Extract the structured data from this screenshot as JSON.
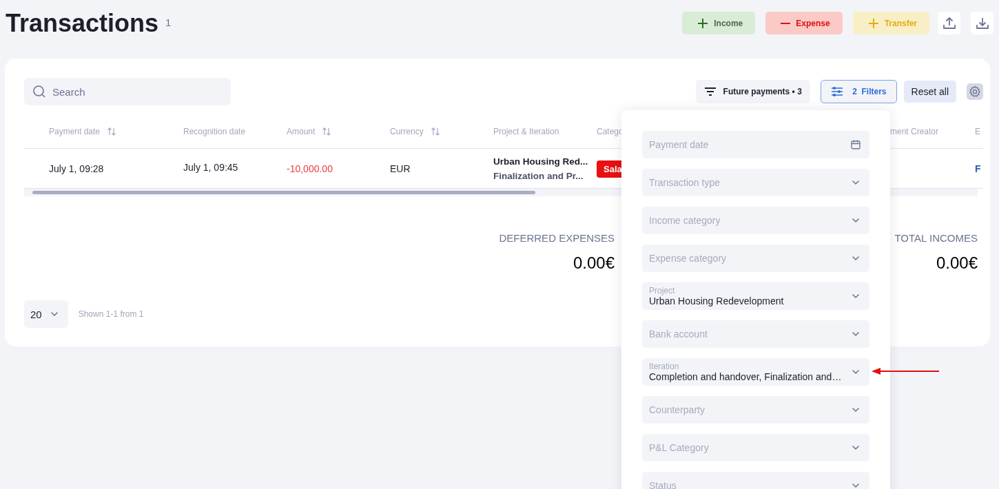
{
  "header": {
    "title": "Transactions",
    "count": "1",
    "actions": [
      {
        "kind": "income",
        "label": "Income"
      },
      {
        "kind": "expense",
        "label": "Expense"
      },
      {
        "kind": "transfer",
        "label": "Transfer"
      }
    ]
  },
  "toolbar": {
    "search": {
      "placeholder": "Search"
    },
    "future_payments": {
      "label": "Future payments • 3"
    },
    "filters": {
      "count": "2",
      "label": "Filters"
    },
    "reset": "Reset all"
  },
  "table": {
    "columns": [
      {
        "label": "Payment date",
        "sortable": true
      },
      {
        "label": "Recognition date",
        "sortable": false
      },
      {
        "label": "Amount",
        "sortable": true
      },
      {
        "label": "Currency",
        "sortable": true
      },
      {
        "label": "Project & Iteration",
        "sortable": false
      },
      {
        "label": "Catego"
      },
      {
        "label": "ment Creator",
        "sortable": false
      },
      {
        "label": "E"
      }
    ],
    "rows": [
      {
        "payment_date": "July 1, 09:28",
        "recognition_date": "July 1, 09:45",
        "amount": "-10,000.00",
        "currency": "EUR",
        "project": "Urban Housing Red...",
        "iteration": "Finalization and Pr...",
        "category": "Sala",
        "column_9": "F"
      }
    ]
  },
  "summary": [
    {
      "label": "DEFERRED EXPENSES",
      "value": "0.00€"
    },
    {
      "label": "TOTAL INCOMES",
      "value": "0.00€"
    }
  ],
  "pagination": {
    "page_size": "20",
    "info": "Shown 1-1 from 1"
  },
  "filter_panel": {
    "fields": [
      {
        "kind": "date",
        "label": "Payment date"
      },
      {
        "kind": "select",
        "label": "Transaction type"
      },
      {
        "kind": "select",
        "label": "Income category"
      },
      {
        "kind": "select",
        "label": "Expense category"
      },
      {
        "kind": "select",
        "label": "Project",
        "value": "Urban Housing Redevelopment"
      },
      {
        "kind": "select",
        "label": "Bank account"
      },
      {
        "kind": "select",
        "label": "Iteration",
        "value": "Completion and handover, Finalization and…"
      },
      {
        "kind": "select",
        "label": "Counterparty"
      },
      {
        "kind": "select",
        "label": "P&L Category"
      },
      {
        "kind": "select",
        "label": "Status"
      }
    ]
  }
}
